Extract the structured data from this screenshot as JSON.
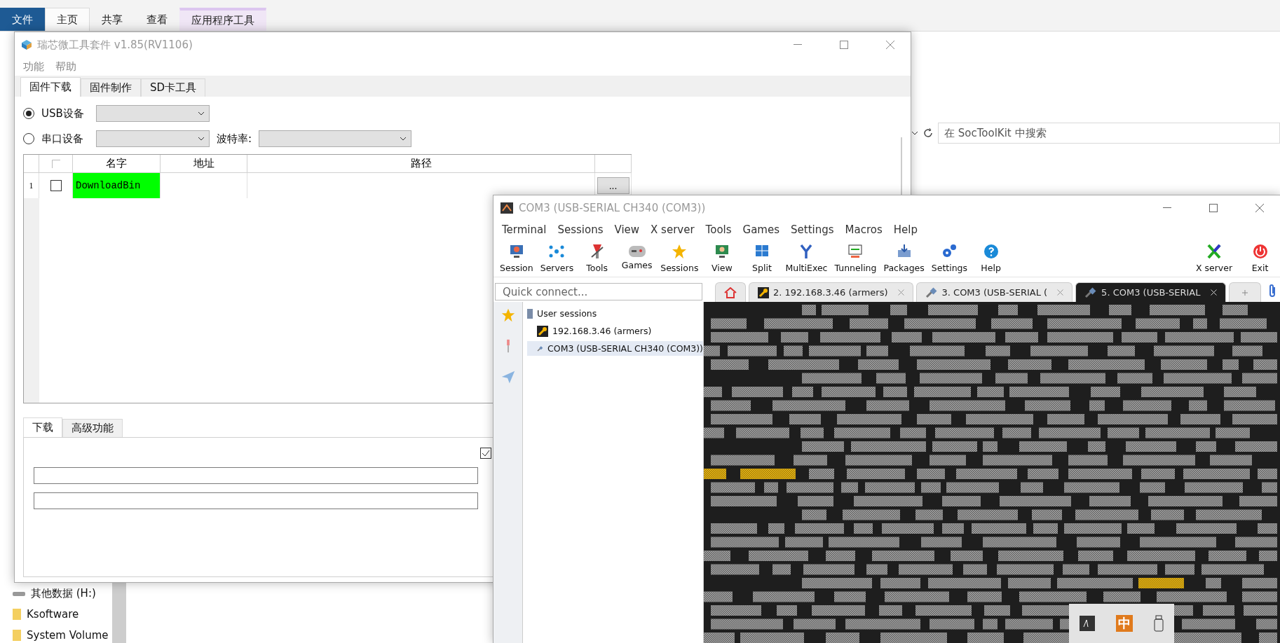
{
  "explorer": {
    "ribbon_tabs": [
      {
        "label": "文件",
        "kind": "file",
        "selected": false
      },
      {
        "label": "主页",
        "kind": "plain",
        "selected": true
      },
      {
        "label": "共享",
        "kind": "plain",
        "selected": false
      },
      {
        "label": "查看",
        "kind": "plain",
        "selected": false
      },
      {
        "label": "应用程序工具",
        "kind": "context",
        "selected": false
      }
    ],
    "search": {
      "placeholder": "在 SocToolKit 中搜索"
    },
    "nav_items": [
      {
        "label": "其他数据 (H:)",
        "kind": "drive"
      },
      {
        "label": "Ksoftware",
        "kind": "folder"
      },
      {
        "label": "System Volume",
        "kind": "folder"
      }
    ]
  },
  "rk_tool": {
    "title": "瑞芯微工具套件 v1.85(RV1106)",
    "menu": [
      "功能",
      "帮助"
    ],
    "tabs": [
      {
        "label": "固件下载",
        "selected": true
      },
      {
        "label": "固件制作",
        "selected": false
      },
      {
        "label": "SD卡工具",
        "selected": false
      }
    ],
    "devices": [
      {
        "label": "USB设备",
        "selected": true
      },
      {
        "label": "串口设备",
        "selected": false
      }
    ],
    "baud_label": "波特率:",
    "table": {
      "columns": [
        "名字",
        "地址",
        "路径"
      ],
      "rows": [
        {
          "index": "1",
          "checked": false,
          "name": "DownloadBin",
          "button": "..."
        }
      ]
    },
    "bottom_tabs": [
      {
        "label": "下载",
        "selected": true
      },
      {
        "label": "高级功能",
        "selected": false
      }
    ],
    "option_checked": true
  },
  "moba": {
    "title": "COM3  (USB-SERIAL CH340 (COM3))",
    "menu": [
      "Terminal",
      "Sessions",
      "View",
      "X server",
      "Tools",
      "Games",
      "Settings",
      "Macros",
      "Help"
    ],
    "toolbar": [
      {
        "label": "Session",
        "kind": "session"
      },
      {
        "label": "Servers",
        "kind": "servers"
      },
      {
        "label": "Tools",
        "kind": "tools"
      },
      {
        "label": "Games",
        "kind": "games"
      },
      {
        "label": "Sessions",
        "kind": "sessions"
      },
      {
        "label": "View",
        "kind": "view"
      },
      {
        "label": "Split",
        "kind": "split"
      },
      {
        "label": "MultiExec",
        "kind": "multiexec"
      },
      {
        "label": "Tunneling",
        "kind": "tunneling"
      },
      {
        "label": "Packages",
        "kind": "packages"
      },
      {
        "label": "Settings",
        "kind": "settings"
      },
      {
        "label": "Help",
        "kind": "help"
      }
    ],
    "toolbar_right": [
      {
        "label": "X server",
        "kind": "xserver"
      },
      {
        "label": "Exit",
        "kind": "exit"
      }
    ],
    "quick_connect": {
      "placeholder": "Quick connect..."
    },
    "tabs": [
      {
        "label": "2. 192.168.3.46 (armers)",
        "kind": "ssh",
        "selected": false
      },
      {
        "label": "3. COM3  (USB-SERIAL (",
        "kind": "serial",
        "selected": false
      },
      {
        "label": "5. COM3  (USB-SERIAL",
        "kind": "serial",
        "selected": true
      }
    ],
    "session_tree": {
      "label": "User sessions",
      "children": [
        {
          "label": "192.168.3.46 (armers)",
          "kind": "ssh",
          "selected": false
        },
        {
          "label": "COM3  (USB-SERIAL CH340 (COM3))",
          "kind": "serial",
          "selected": true
        }
      ]
    },
    "ime_indicator": "中"
  }
}
